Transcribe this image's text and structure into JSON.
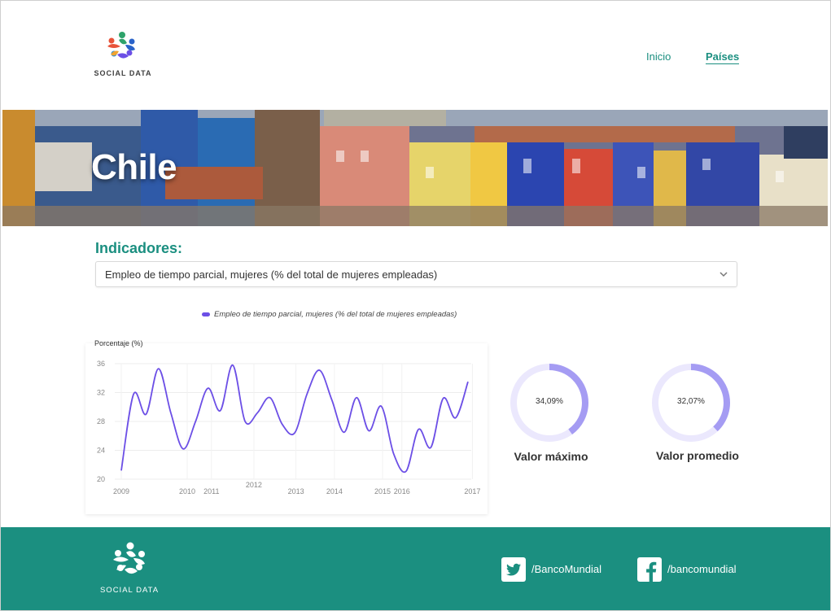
{
  "brand": {
    "name": "SOCIAL DATA"
  },
  "nav": {
    "inicio": "Inicio",
    "paises": "Países"
  },
  "hero": {
    "title": "Chile"
  },
  "indicators": {
    "label": "Indicadores:",
    "selected": "Empleo de tiempo parcial, mujeres (% del total de mujeres empleadas)"
  },
  "chart_data": {
    "type": "line",
    "ylabel": "Porcentaje (%)",
    "ylim": [
      20,
      36
    ],
    "yticks": [
      "36",
      "32",
      "28",
      "24",
      "20"
    ],
    "x_tick_labels": [
      "2009",
      "2010",
      "2011",
      "2012",
      "2013",
      "2014",
      "2015",
      "2016",
      "2017"
    ],
    "series": [
      {
        "name": "Empleo de tiempo parcial, mujeres (% del total de mujeres empleadas)",
        "color": "#6c4fe6",
        "values": [
          21.2,
          31.8,
          29.0,
          35.3,
          29.2,
          24.2,
          28.0,
          32.6,
          29.5,
          35.8,
          28.0,
          29.2,
          31.3,
          27.6,
          26.4,
          31.8,
          35.1,
          31.0,
          26.5,
          31.3,
          26.7,
          30.1,
          23.5,
          21.1,
          26.9,
          24.4,
          31.2,
          28.5,
          33.5
        ]
      }
    ],
    "grid": true,
    "legend": "top"
  },
  "stats": {
    "max": {
      "value": "34,09%",
      "label": "Valor máximo",
      "fraction": 0.34
    },
    "avg": {
      "value": "32,07%",
      "label": "Valor promedio",
      "fraction": 0.32
    }
  },
  "footer": {
    "twitter": "/BancoMundial",
    "facebook": "/bancomundial",
    "twitter_icon": "twitter-icon",
    "facebook_icon": "facebook-icon"
  },
  "colors": {
    "teal": "#1b8f80",
    "purple": "#6c4fe6",
    "gauge": "#a59cf3",
    "gauge_track": "#ebe8fd"
  }
}
